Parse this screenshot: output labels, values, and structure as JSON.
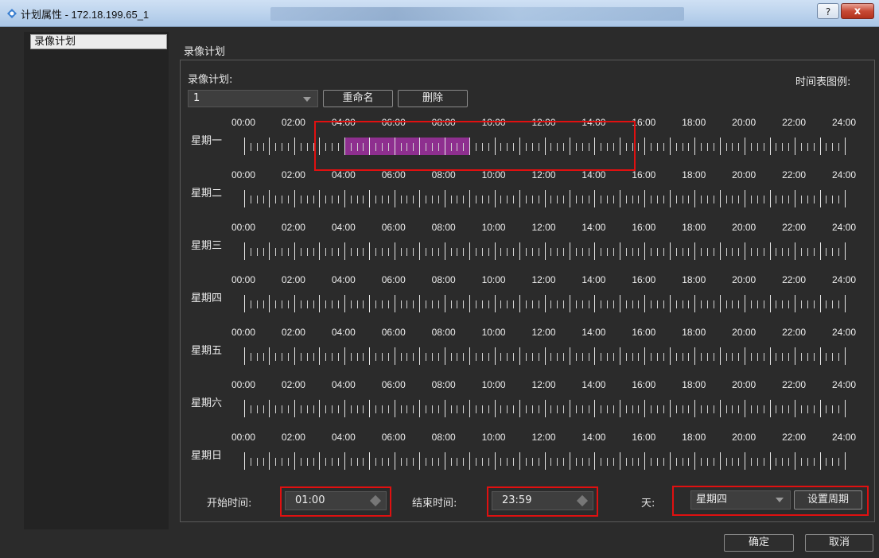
{
  "window": {
    "title": "计划属性 - 172.18.199.65_1",
    "help_label": "?",
    "close_label": "x"
  },
  "sidebar": {
    "items": [
      {
        "label": "录像计划"
      }
    ]
  },
  "panel": {
    "title": "录像计划",
    "schedule_label": "录像计划:",
    "legend_label": "时间表图例:",
    "schedule_value": "1",
    "rename_label": "重命名",
    "delete_label": "删除"
  },
  "timeline": {
    "hour_labels": [
      "00:00",
      "02:00",
      "04:00",
      "06:00",
      "08:00",
      "10:00",
      "12:00",
      "14:00",
      "16:00",
      "18:00",
      "20:00",
      "22:00",
      "24:00"
    ],
    "days": [
      {
        "name": "星期一",
        "segments": [
          {
            "start": 4.0,
            "end": 9.0
          }
        ]
      },
      {
        "name": "星期二",
        "segments": []
      },
      {
        "name": "星期三",
        "segments": []
      },
      {
        "name": "星期四",
        "segments": []
      },
      {
        "name": "星期五",
        "segments": []
      },
      {
        "name": "星期六",
        "segments": []
      },
      {
        "name": "星期日",
        "segments": []
      }
    ],
    "segment_color": "#8e2f8f"
  },
  "footer": {
    "start_label": "开始时间:",
    "start_value": "01:00",
    "end_label": "结束时间:",
    "end_value": "23:59",
    "day_label": "天:",
    "day_value": "星期四",
    "set_period_label": "设置周期"
  },
  "dialog_buttons": {
    "ok_label": "确定",
    "cancel_label": "取消"
  },
  "colors": {
    "highlight": "#e01010"
  }
}
